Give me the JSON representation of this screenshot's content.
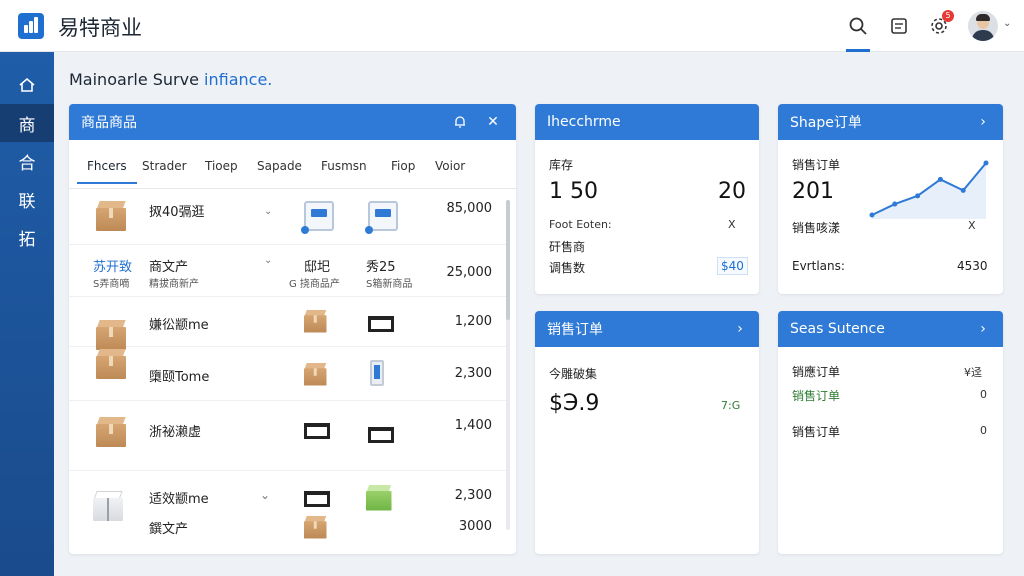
{
  "app": {
    "title": "易特商业"
  },
  "colors": {
    "accent": "#2f7ad6",
    "sidebar": "#1f5da8",
    "badge": "#e53935"
  },
  "header": {
    "icons": [
      "search-icon",
      "notes-icon",
      "settings-icon",
      "user-avatar"
    ],
    "notification_count": "5"
  },
  "sidebar": {
    "items": [
      {
        "icon": "home-icon",
        "label": ""
      },
      {
        "label": "商"
      },
      {
        "label": "合"
      },
      {
        "label": "联"
      },
      {
        "label": "拓"
      }
    ]
  },
  "page": {
    "title": "Mainoarle Surve",
    "title_suffix": "infiance."
  },
  "products_panel": {
    "title": "商品商品",
    "tabs": [
      "Fhcers",
      "Strader",
      "Tioep",
      "Sapade",
      "Fusmsn",
      "Fiop",
      "Voior"
    ],
    "rows": [
      {
        "name": "㧐40㣂逛",
        "sub": "",
        "value": "85,000"
      },
      {
        "name": "苏开致",
        "sub": "S弄商嘀",
        "col2": "商文产",
        "col2_sub": "精拔商新产",
        "col3": "邸圯",
        "col3_sub": "G 挠商品产",
        "col4": "秀25",
        "col4_sub": "S箱新商品",
        "value": "25,000"
      },
      {
        "name": "嫌彸颛me",
        "value": "1,200"
      },
      {
        "name": "㯐颐Tome",
        "value": "2,300"
      },
      {
        "name": "浙祕濑虚",
        "value": "1,400"
      },
      {
        "name": "适效颛me",
        "name2": "鐉文产",
        "value": "2,300",
        "value2": "3000"
      }
    ]
  },
  "card_top_left": {
    "title": "Ihecchrme",
    "label": "库存",
    "big_left": "1 50",
    "big_right": "20",
    "row1_label": "Foot Eoten:",
    "row1_value": "X",
    "row2_label": "矸售商",
    "row3_label": "调售数",
    "row3_value": "$40"
  },
  "card_top_right": {
    "title": "Shape订单",
    "label": "销售订单",
    "big": "201",
    "row1_label": "销售咳漾",
    "row1_value": "X",
    "row2_label": "Evrtlans:",
    "row2_value": "4530",
    "sparkline": [
      18,
      22,
      25,
      31,
      27,
      37
    ]
  },
  "card_bottom_left": {
    "title": "销售订单",
    "label": "今雕破集",
    "big": "$Э.9",
    "small": "7:G"
  },
  "card_bottom_right": {
    "title": "Seas Sutence",
    "rows": [
      {
        "label": "销應订单",
        "value": "¥迳"
      },
      {
        "label": "销售订单",
        "value": "0"
      },
      {
        "label": "销售订单",
        "value": "0"
      }
    ]
  }
}
